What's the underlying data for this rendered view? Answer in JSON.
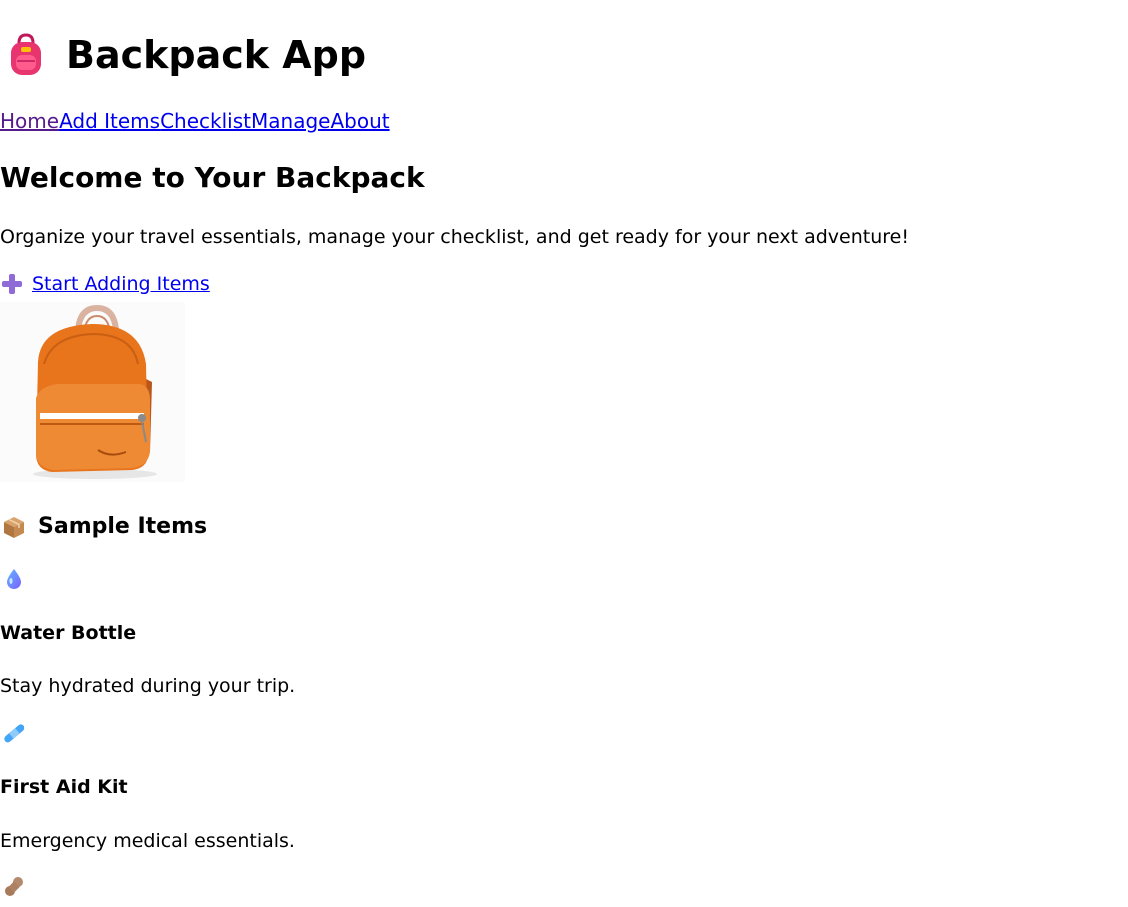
{
  "header": {
    "title": "Backpack App",
    "title_icon": "backpack-icon"
  },
  "nav": {
    "items": [
      {
        "label": "Home",
        "visited": true
      },
      {
        "label": "Add Items",
        "visited": false
      },
      {
        "label": "Checklist",
        "visited": false
      },
      {
        "label": "Manage",
        "visited": false
      },
      {
        "label": "About",
        "visited": false
      }
    ]
  },
  "hero": {
    "heading": "Welcome to Your Backpack",
    "intro": "Organize your travel essentials, manage your checklist, and get ready for your next adventure!",
    "cta_icon": "plus-icon",
    "cta_label": "Start Adding Items",
    "image_subject": "orange backpack photo"
  },
  "sample": {
    "heading": "Sample Items",
    "heading_icon": "package-icon",
    "items": [
      {
        "icon": "droplet-icon",
        "name": "Water Bottle",
        "description": "Stay hydrated during your trip."
      },
      {
        "icon": "bandage-icon",
        "name": "First Aid Kit",
        "description": "Emergency medical essentials."
      },
      {
        "icon": "peanut-icon",
        "name": "",
        "description": ""
      }
    ]
  },
  "colors": {
    "link": "#0000ee",
    "visited_link": "#551a8b",
    "backpack_orange": "#e8741c",
    "title_icon_pink": "#e8346f"
  }
}
